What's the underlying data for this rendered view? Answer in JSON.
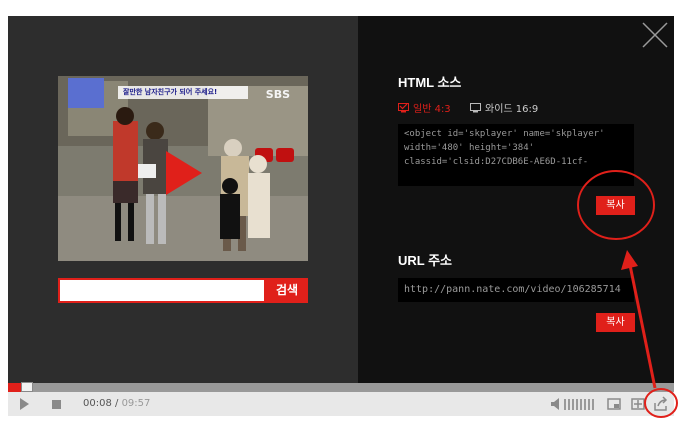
{
  "share_panel": {
    "html_source": {
      "title": "HTML 소스",
      "ratio_normal": "일반 4:3",
      "ratio_wide": "와이드 16:9",
      "code_lines": [
        "<object id='skplayer' name='skplayer'",
        "width='480' height='384'",
        "classid='clsid:D27CDB6E-AE6D-11cf-"
      ],
      "copy_label": "복사"
    },
    "url": {
      "title": "URL 주소",
      "value": "http://pann.nate.com/video/106285714",
      "copy_label": "복사"
    }
  },
  "search": {
    "value": "",
    "button_label": "검색"
  },
  "video": {
    "caption": "잘만한 남자친구가 되어 주세요!",
    "channel_logo": "SBS"
  },
  "controls": {
    "current_time": "00:08",
    "separator": " / ",
    "total_time": "09:57",
    "progress": 0.02
  },
  "colors": {
    "accent": "#e0201a",
    "panel_dark": "#2d2d2d",
    "panel_black": "#111111",
    "annotation": "#e0201a"
  },
  "icons": {
    "close": "close-icon",
    "play": "play-icon",
    "stop": "stop-icon",
    "volume": "volume-icon",
    "share": "share-icon"
  }
}
